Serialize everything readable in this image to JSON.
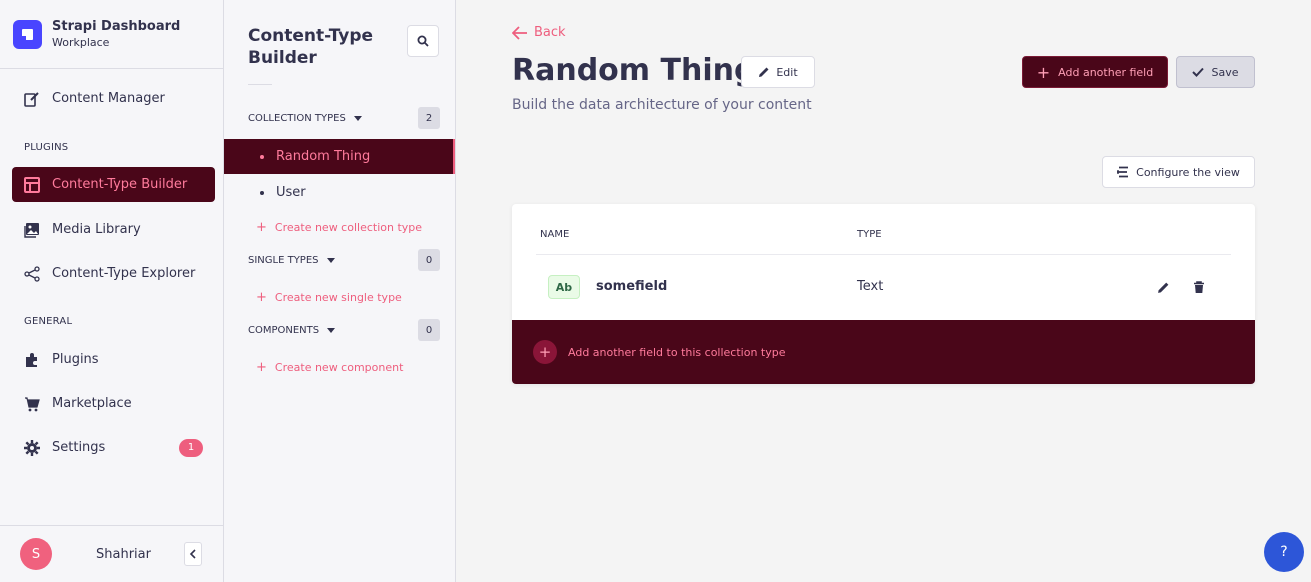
{
  "brand": {
    "title": "Strapi Dashboard",
    "subtitle": "Workplace"
  },
  "mainnav": {
    "content_manager": {
      "label": "Content Manager",
      "icon": "pencil-book-icon"
    },
    "plugins_section": "PLUGINS",
    "content_type_builder": {
      "label": "Content-Type Builder",
      "icon": "layout-icon"
    },
    "media_library": {
      "label": "Media Library",
      "icon": "image-icon"
    },
    "content_type_explorer": {
      "label": "Content-Type Explorer",
      "icon": "share-nodes-icon"
    },
    "general_section": "GENERAL",
    "plugins": {
      "label": "Plugins",
      "icon": "puzzle-icon"
    },
    "marketplace": {
      "label": "Marketplace",
      "icon": "cart-icon"
    },
    "settings": {
      "label": "Settings",
      "icon": "gear-icon",
      "badge": "1"
    }
  },
  "profile": {
    "initial": "S",
    "name": "Shahriar"
  },
  "subnav": {
    "title": "Content-Type Builder",
    "collection_types": {
      "label": "COLLECTION TYPES",
      "count": "2",
      "items": [
        "Random Thing",
        "User"
      ],
      "create": "Create new collection type"
    },
    "single_types": {
      "label": "SINGLE TYPES",
      "count": "0",
      "create": "Create new single type"
    },
    "components": {
      "label": "COMPONENTS",
      "count": "0",
      "create": "Create new component"
    }
  },
  "header": {
    "back": "Back",
    "title": "Random Thing",
    "edit": "Edit",
    "subtitle": "Build the data architecture of your content",
    "add_field": "Add another field",
    "save": "Save",
    "configure": "Configure the view"
  },
  "table": {
    "headers": {
      "name": "NAME",
      "type": "TYPE"
    },
    "rows": [
      {
        "icon_text": "Ab",
        "name": "somefield",
        "type": "Text"
      }
    ],
    "add_row": "Add another field to this collection type"
  },
  "help": "?",
  "colors": {
    "accent_dark": "#4a0619",
    "accent_pink": "#ee5e7e",
    "brand_blue": "#4945ff"
  }
}
